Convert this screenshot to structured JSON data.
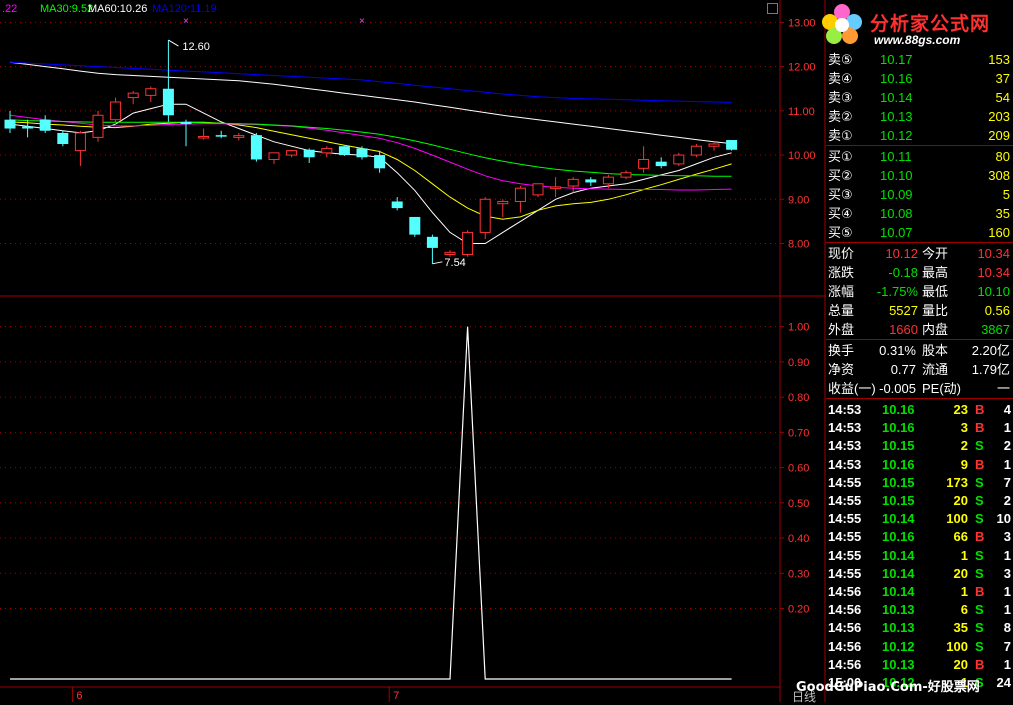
{
  "ma_labels": [
    {
      "text": ".22",
      "color": "#ff00ff"
    },
    {
      "text": "MA30:9.52",
      "color": "#00ff00"
    },
    {
      "text": "MA60:10.26",
      "color": "#ffffff"
    },
    {
      "text": "MA120:11.19",
      "color": "#0000ff"
    }
  ],
  "colors": {
    "up": "#ff3232",
    "down": "#54ffff",
    "grid": "#a00000",
    "axis_text": "#ff3232",
    "ma5": "#ffffff",
    "ma10": "#ffff00",
    "ma20": "#ff00ff",
    "ma30": "#00ff00",
    "ma60": "#ffffff",
    "ma120": "#0000ff"
  },
  "main_axis": {
    "ticks": [
      "13.00",
      "12.00",
      "11.00",
      "10.00",
      "9.00",
      "8.00"
    ]
  },
  "sub_axis": {
    "ticks": [
      "1.00",
      "0.90",
      "0.80",
      "0.70",
      "0.60",
      "0.50",
      "0.40",
      "0.30",
      "0.20"
    ]
  },
  "date_labels": [
    "6",
    "7"
  ],
  "annotations": {
    "high": "12.60",
    "low": "7.54"
  },
  "chart_data": {
    "type": "candlestick",
    "ylim": [
      7.4,
      13.1
    ],
    "candles": [
      {
        "o": 10.8,
        "h": 11.0,
        "l": 10.5,
        "c": 10.6
      },
      {
        "o": 10.65,
        "h": 10.8,
        "l": 10.4,
        "c": 10.6
      },
      {
        "o": 10.8,
        "h": 10.9,
        "l": 10.5,
        "c": 10.55
      },
      {
        "o": 10.5,
        "h": 10.55,
        "l": 10.2,
        "c": 10.25
      },
      {
        "o": 10.1,
        "h": 10.55,
        "l": 9.75,
        "c": 10.5
      },
      {
        "o": 10.4,
        "h": 11.0,
        "l": 10.3,
        "c": 10.9
      },
      {
        "o": 10.8,
        "h": 11.3,
        "l": 10.7,
        "c": 11.2
      },
      {
        "o": 11.3,
        "h": 11.45,
        "l": 11.15,
        "c": 11.4
      },
      {
        "o": 11.35,
        "h": 11.55,
        "l": 11.2,
        "c": 11.5
      },
      {
        "o": 11.5,
        "h": 12.6,
        "l": 10.75,
        "c": 10.9
      },
      {
        "o": 10.75,
        "h": 10.8,
        "l": 10.2,
        "c": 10.7
      },
      {
        "o": 10.4,
        "h": 10.6,
        "l": 10.35,
        "c": 10.42
      },
      {
        "o": 10.45,
        "h": 10.55,
        "l": 10.38,
        "c": 10.42
      },
      {
        "o": 10.4,
        "h": 10.5,
        "l": 10.33,
        "c": 10.44
      },
      {
        "o": 10.45,
        "h": 10.5,
        "l": 9.85,
        "c": 9.9
      },
      {
        "o": 9.9,
        "h": 10.05,
        "l": 9.8,
        "c": 10.05
      },
      {
        "o": 10.0,
        "h": 10.12,
        "l": 9.95,
        "c": 10.1
      },
      {
        "o": 10.12,
        "h": 10.15,
        "l": 9.82,
        "c": 9.95
      },
      {
        "o": 10.05,
        "h": 10.2,
        "l": 9.95,
        "c": 10.15
      },
      {
        "o": 10.2,
        "h": 10.2,
        "l": 9.98,
        "c": 10.0
      },
      {
        "o": 10.15,
        "h": 10.2,
        "l": 9.9,
        "c": 9.95
      },
      {
        "o": 10.0,
        "h": 10.1,
        "l": 9.6,
        "c": 9.7
      },
      {
        "o": 8.95,
        "h": 9.05,
        "l": 8.75,
        "c": 8.8
      },
      {
        "o": 8.6,
        "h": 8.6,
        "l": 8.15,
        "c": 8.2
      },
      {
        "o": 8.15,
        "h": 8.2,
        "l": 7.54,
        "c": 7.9
      },
      {
        "o": 7.75,
        "h": 7.85,
        "l": 7.7,
        "c": 7.8
      },
      {
        "o": 7.75,
        "h": 8.3,
        "l": 7.7,
        "c": 8.25
      },
      {
        "o": 8.25,
        "h": 9.05,
        "l": 8.1,
        "c": 9.0
      },
      {
        "o": 8.9,
        "h": 9.0,
        "l": 8.6,
        "c": 8.95
      },
      {
        "o": 8.95,
        "h": 9.3,
        "l": 8.7,
        "c": 9.25
      },
      {
        "o": 9.1,
        "h": 9.35,
        "l": 9.05,
        "c": 9.35
      },
      {
        "o": 9.25,
        "h": 9.5,
        "l": 9.05,
        "c": 9.28
      },
      {
        "o": 9.3,
        "h": 9.5,
        "l": 9.15,
        "c": 9.45
      },
      {
        "o": 9.45,
        "h": 9.5,
        "l": 9.3,
        "c": 9.38
      },
      {
        "o": 9.35,
        "h": 9.55,
        "l": 9.25,
        "c": 9.5
      },
      {
        "o": 9.5,
        "h": 9.65,
        "l": 9.45,
        "c": 9.6
      },
      {
        "o": 9.7,
        "h": 10.2,
        "l": 9.6,
        "c": 9.9
      },
      {
        "o": 9.85,
        "h": 9.95,
        "l": 9.7,
        "c": 9.75
      },
      {
        "o": 9.8,
        "h": 10.05,
        "l": 9.75,
        "c": 10.0
      },
      {
        "o": 10.0,
        "h": 10.25,
        "l": 9.95,
        "c": 10.2
      },
      {
        "o": 10.2,
        "h": 10.3,
        "l": 10.1,
        "c": 10.25
      },
      {
        "o": 10.34,
        "h": 10.34,
        "l": 10.1,
        "c": 10.12
      }
    ],
    "moving_averages": [
      {
        "name": "MA5",
        "values": [
          10.7,
          10.65,
          10.6,
          10.55,
          10.5,
          10.55,
          10.7,
          10.95,
          11.05,
          11.15,
          11.15,
          10.95,
          10.75,
          10.6,
          10.45,
          10.3,
          10.2,
          10.1,
          10.05,
          10.02,
          10.0,
          9.95,
          9.6,
          9.2,
          8.7,
          8.25,
          8.0,
          8.0,
          8.25,
          8.5,
          8.75,
          9.0,
          9.15,
          9.25,
          9.3,
          9.35,
          9.45,
          9.55,
          9.65,
          9.8,
          9.95,
          10.05
        ]
      },
      {
        "name": "MA10",
        "values": [
          10.75,
          10.73,
          10.7,
          10.68,
          10.65,
          10.63,
          10.62,
          10.65,
          10.7,
          10.72,
          10.74,
          10.74,
          10.72,
          10.68,
          10.62,
          10.54,
          10.46,
          10.38,
          10.3,
          10.22,
          10.15,
          10.08,
          9.9,
          9.65,
          9.35,
          9.05,
          8.8,
          8.62,
          8.55,
          8.6,
          8.75,
          8.85,
          8.9,
          8.93,
          9.0,
          9.1,
          9.22,
          9.33,
          9.45,
          9.57,
          9.68,
          9.8
        ]
      },
      {
        "name": "MA20",
        "values": [
          10.9,
          10.85,
          10.8,
          10.76,
          10.72,
          10.68,
          10.66,
          10.66,
          10.67,
          10.69,
          10.7,
          10.71,
          10.71,
          10.7,
          10.69,
          10.67,
          10.65,
          10.61,
          10.56,
          10.5,
          10.44,
          10.38,
          10.28,
          10.15,
          10.0,
          9.84,
          9.68,
          9.53,
          9.42,
          9.35,
          9.3,
          9.27,
          9.25,
          9.24,
          9.23,
          9.22,
          9.22,
          9.22,
          9.21,
          9.21,
          9.22,
          9.23
        ]
      },
      {
        "name": "MA30",
        "values": [
          10.8,
          10.78,
          10.77,
          10.76,
          10.75,
          10.74,
          10.74,
          10.74,
          10.74,
          10.74,
          10.74,
          10.73,
          10.72,
          10.71,
          10.7,
          10.68,
          10.66,
          10.63,
          10.6,
          10.56,
          10.52,
          10.47,
          10.4,
          10.32,
          10.23,
          10.13,
          10.03,
          9.94,
          9.86,
          9.79,
          9.73,
          9.68,
          9.64,
          9.61,
          9.58,
          9.56,
          9.55,
          9.54,
          9.53,
          9.53,
          9.52,
          9.52
        ]
      },
      {
        "name": "MA60",
        "values": [
          12.1,
          12.05,
          12.0,
          11.95,
          11.9,
          11.85,
          11.82,
          11.8,
          11.78,
          11.76,
          11.74,
          11.72,
          11.7,
          11.68,
          11.64,
          11.6,
          11.55,
          11.5,
          11.45,
          11.4,
          11.35,
          11.3,
          11.25,
          11.2,
          11.14,
          11.08,
          11.02,
          10.96,
          10.9,
          10.85,
          10.8,
          10.75,
          10.7,
          10.65,
          10.6,
          10.55,
          10.5,
          10.45,
          10.4,
          10.35,
          10.3,
          10.26
        ]
      },
      {
        "name": "MA120",
        "values": [
          12.1,
          12.08,
          12.06,
          12.04,
          12.02,
          12.0,
          11.98,
          11.96,
          11.94,
          11.92,
          11.9,
          11.88,
          11.86,
          11.84,
          11.82,
          11.8,
          11.78,
          11.76,
          11.74,
          11.72,
          11.7,
          11.66,
          11.62,
          11.58,
          11.54,
          11.5,
          11.46,
          11.42,
          11.38,
          11.35,
          11.32,
          11.3,
          11.28,
          11.27,
          11.26,
          11.25,
          11.24,
          11.23,
          11.22,
          11.21,
          11.2,
          11.19
        ]
      }
    ],
    "indicator": {
      "ylim": [
        0,
        1.05
      ],
      "values": [
        0,
        0,
        0,
        0,
        0,
        0,
        0,
        0,
        0,
        0,
        0,
        0,
        0,
        0,
        0,
        0,
        0,
        0,
        0,
        0,
        0,
        0,
        0,
        0,
        0,
        0,
        1,
        0,
        0,
        0,
        0,
        0,
        0,
        0,
        0,
        0,
        0,
        0,
        0,
        0,
        0,
        0
      ]
    }
  },
  "logo": {
    "text": "分析家公式网",
    "url": "www.88gs.com"
  },
  "watermark": "GoodGuPiao.Com-好股票网",
  "bottom_tab": "日线",
  "order_book": {
    "asks": [
      {
        "label": "卖⑤",
        "price": "10.17",
        "vol": "153"
      },
      {
        "label": "卖④",
        "price": "10.16",
        "vol": "37"
      },
      {
        "label": "卖③",
        "price": "10.14",
        "vol": "54"
      },
      {
        "label": "卖②",
        "price": "10.13",
        "vol": "203"
      },
      {
        "label": "卖①",
        "price": "10.12",
        "vol": "209"
      }
    ],
    "bids": [
      {
        "label": "买①",
        "price": "10.11",
        "vol": "80"
      },
      {
        "label": "买②",
        "price": "10.10",
        "vol": "308"
      },
      {
        "label": "买③",
        "price": "10.09",
        "vol": "5"
      },
      {
        "label": "买④",
        "price": "10.08",
        "vol": "35"
      },
      {
        "label": "买⑤",
        "price": "10.07",
        "vol": "160"
      }
    ]
  },
  "quote": [
    {
      "l1": "现价",
      "v1": "10.12",
      "c1": "#ff3232",
      "l2": "今开",
      "v2": "10.34",
      "c2": "#ff3232"
    },
    {
      "l1": "涨跌",
      "v1": "-0.18",
      "c1": "#00e000",
      "l2": "最高",
      "v2": "10.34",
      "c2": "#ff3232"
    },
    {
      "l1": "涨幅",
      "v1": "-1.75%",
      "c1": "#00e000",
      "l2": "最低",
      "v2": "10.10",
      "c2": "#00e000"
    },
    {
      "l1": "总量",
      "v1": "5527",
      "c1": "#ffff00",
      "l2": "量比",
      "v2": "0.56",
      "c2": "#ffff00"
    },
    {
      "l1": "外盘",
      "v1": "1660",
      "c1": "#ff3232",
      "l2": "内盘",
      "v2": "3867",
      "c2": "#00e000"
    }
  ],
  "fundamentals": [
    {
      "l1": "换手",
      "v1": "0.31%",
      "l2": "股本",
      "v2": "2.20亿"
    },
    {
      "l1": "净资",
      "v1": "0.77",
      "l2": "流通",
      "v2": "1.79亿"
    },
    {
      "l1": "收益(一)",
      "v1": "-0.005",
      "l2": "PE(动)",
      "v2": "一"
    }
  ],
  "ticks": [
    {
      "time": "14:53",
      "price": "10.16",
      "vol": "23",
      "side": "B",
      "n": "4"
    },
    {
      "time": "14:53",
      "price": "10.16",
      "vol": "3",
      "side": "B",
      "n": "1"
    },
    {
      "time": "14:53",
      "price": "10.15",
      "vol": "2",
      "side": "S",
      "n": "2"
    },
    {
      "time": "14:53",
      "price": "10.16",
      "vol": "9",
      "side": "B",
      "n": "1"
    },
    {
      "time": "14:55",
      "price": "10.15",
      "vol": "173",
      "side": "S",
      "n": "7"
    },
    {
      "time": "14:55",
      "price": "10.15",
      "vol": "20",
      "side": "S",
      "n": "2"
    },
    {
      "time": "14:55",
      "price": "10.14",
      "vol": "100",
      "side": "S",
      "n": "10"
    },
    {
      "time": "14:55",
      "price": "10.16",
      "vol": "66",
      "side": "B",
      "n": "3"
    },
    {
      "time": "14:55",
      "price": "10.14",
      "vol": "1",
      "side": "S",
      "n": "1"
    },
    {
      "time": "14:55",
      "price": "10.14",
      "vol": "20",
      "side": "S",
      "n": "3"
    },
    {
      "time": "14:56",
      "price": "10.14",
      "vol": "1",
      "side": "B",
      "n": "1"
    },
    {
      "time": "14:56",
      "price": "10.13",
      "vol": "6",
      "side": "S",
      "n": "1"
    },
    {
      "time": "14:56",
      "price": "10.13",
      "vol": "35",
      "side": "S",
      "n": "8"
    },
    {
      "time": "14:56",
      "price": "10.12",
      "vol": "100",
      "side": "S",
      "n": "7"
    },
    {
      "time": "14:56",
      "price": "10.13",
      "vol": "20",
      "side": "B",
      "n": "1"
    },
    {
      "time": "15:00",
      "price": "10.12",
      "vol": "1",
      "side": "S",
      "n": "24"
    }
  ]
}
